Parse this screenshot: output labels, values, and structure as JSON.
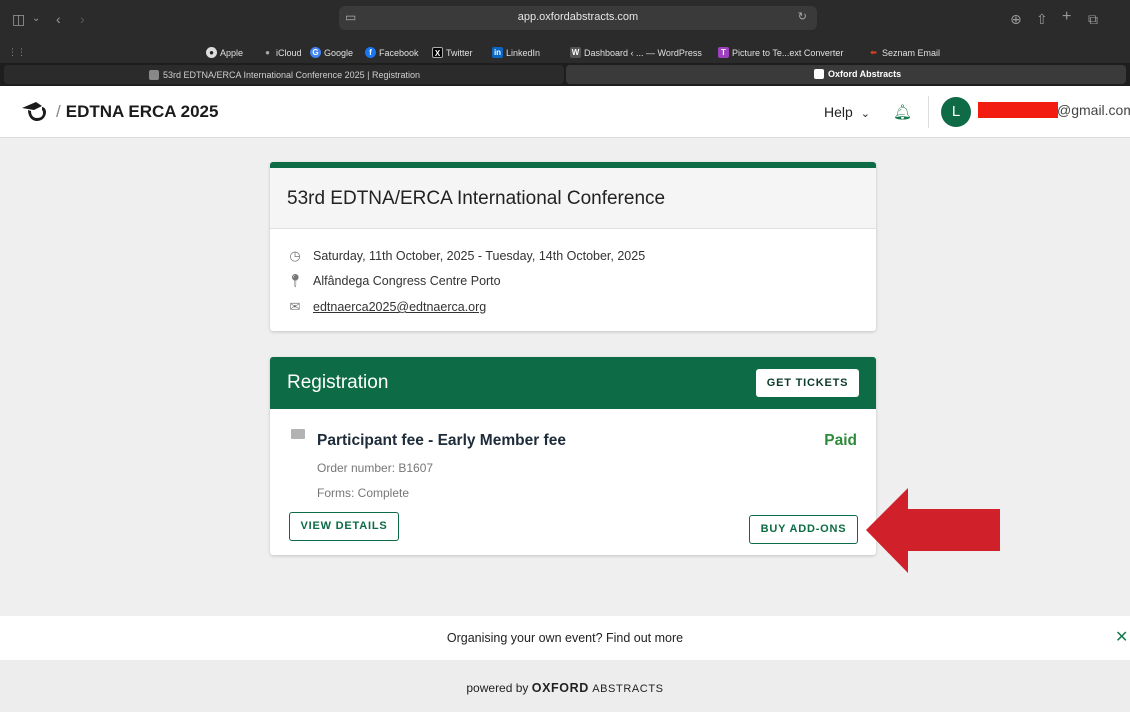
{
  "browser": {
    "url": "app.oxfordabstracts.com",
    "bookmarks": [
      "Apple",
      "iCloud",
      "Google",
      "Facebook",
      "Twitter",
      "LinkedIn",
      "Dashboard ‹ ... — WordPress",
      "Picture to Te...ext Converter",
      "Seznam Email"
    ],
    "tabs": [
      "53rd EDTNA/ERCA International Conference 2025 | Registration",
      "Oxford Abstracts"
    ]
  },
  "header": {
    "brand": "EDTNA ERCA 2025",
    "slash": "/",
    "help_label": "Help",
    "avatar_initial": "L",
    "email_tail": "@gmail.com"
  },
  "conference": {
    "title": "53rd EDTNA/ERCA International Conference",
    "dates": "Saturday, 11th October, 2025 - Tuesday, 14th October, 2025",
    "venue": "Alfândega Congress Centre Porto",
    "email": "edtnaerca2025@edtnaerca.org"
  },
  "registration": {
    "title": "Registration",
    "get_tickets_label": "GET TICKETS",
    "fee_title": "Participant fee - Early Member fee",
    "status": "Paid",
    "order_number": "Order number: B1607",
    "forms": "Forms: Complete",
    "view_details_label": "VIEW DETAILS",
    "buy_addons_label": "BUY ADD-ONS"
  },
  "footer": {
    "promo": "Organising your own event? Find out more",
    "powered_prefix": "powered by",
    "powered_brand": "OXFORD",
    "powered_suffix": "ABSTRACTS"
  },
  "colors": {
    "primary": "#0d6b45",
    "paid": "#2e8b3a",
    "arrow": "#d0202a",
    "redaction": "#f21d10"
  }
}
